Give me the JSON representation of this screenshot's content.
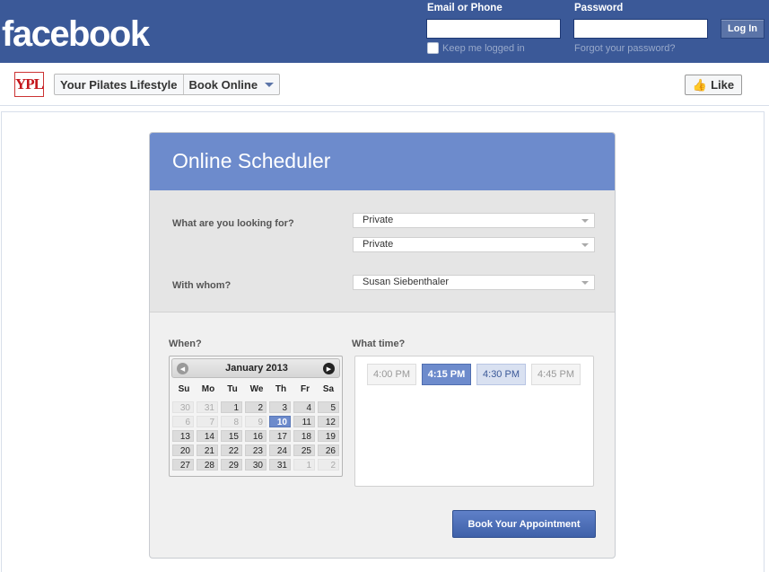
{
  "facebook": {
    "logo": "facebook",
    "email_label": "Email or Phone",
    "password_label": "Password",
    "keep_logged_in": "Keep me logged in",
    "forgot_password": "Forgot your password?",
    "login_button": "Log In"
  },
  "page": {
    "logo_text": "YPL",
    "name": "Your Pilates Lifestyle",
    "tab": "Book Online",
    "like_button": "Like"
  },
  "scheduler": {
    "title": "Online Scheduler",
    "looking_for_label": "What are you looking for?",
    "service_type": "Private",
    "service": "Private",
    "with_whom_label": "With whom?",
    "staff": "Susan Siebenthaler",
    "when_label": "When?",
    "what_time_label": "What time?",
    "book_button": "Book Your Appointment"
  },
  "calendar": {
    "month": "January 2013",
    "days_of_week": [
      "Su",
      "Mo",
      "Tu",
      "We",
      "Th",
      "Fr",
      "Sa"
    ],
    "weeks": [
      [
        "30",
        "31",
        "1",
        "2",
        "3",
        "4",
        "5"
      ],
      [
        "6",
        "7",
        "8",
        "9",
        "10",
        "11",
        "12"
      ],
      [
        "13",
        "14",
        "15",
        "16",
        "17",
        "18",
        "19"
      ],
      [
        "20",
        "21",
        "22",
        "23",
        "24",
        "25",
        "26"
      ],
      [
        "27",
        "28",
        "29",
        "30",
        "31",
        "1",
        "2"
      ]
    ],
    "selected_day": "10"
  },
  "times": [
    "4:00 PM",
    "4:15 PM",
    "4:30 PM",
    "4:45 PM"
  ],
  "selected_time": "4:15 PM",
  "colors": {
    "facebook_blue": "#3b5998",
    "scheduler_header": "#6d8bcc",
    "book_button": "#4a6bb5"
  }
}
